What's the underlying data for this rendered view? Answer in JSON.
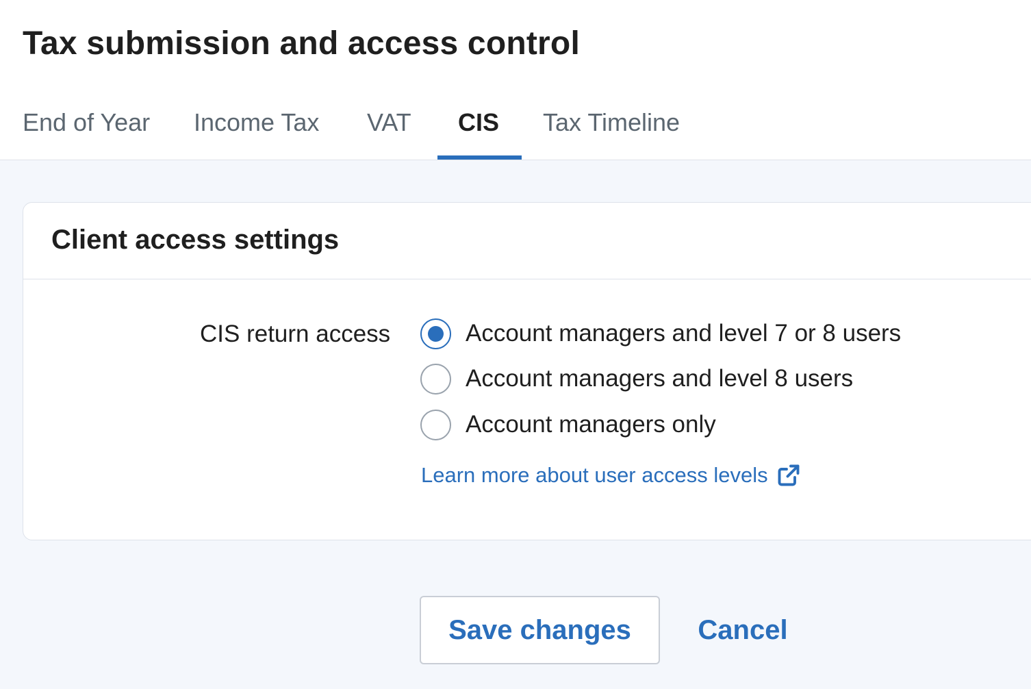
{
  "page": {
    "title": "Tax submission and access control"
  },
  "tabs": [
    {
      "label": "End of Year",
      "active": false
    },
    {
      "label": "Income Tax",
      "active": false
    },
    {
      "label": "VAT",
      "active": false
    },
    {
      "label": "CIS",
      "active": true
    },
    {
      "label": "Tax Timeline",
      "active": false
    }
  ],
  "card": {
    "title": "Client access settings",
    "field_label": "CIS return access",
    "options": [
      {
        "label": "Account managers and level 7 or 8 users",
        "selected": true
      },
      {
        "label": "Account managers and level 8 users",
        "selected": false
      },
      {
        "label": "Account managers only",
        "selected": false
      }
    ],
    "link": {
      "label": "Learn more about user access levels",
      "icon": "external-link-icon"
    }
  },
  "actions": {
    "save_label": "Save changes",
    "cancel_label": "Cancel"
  },
  "colors": {
    "accent": "#2a6ebb",
    "background": "#f4f7fc"
  }
}
